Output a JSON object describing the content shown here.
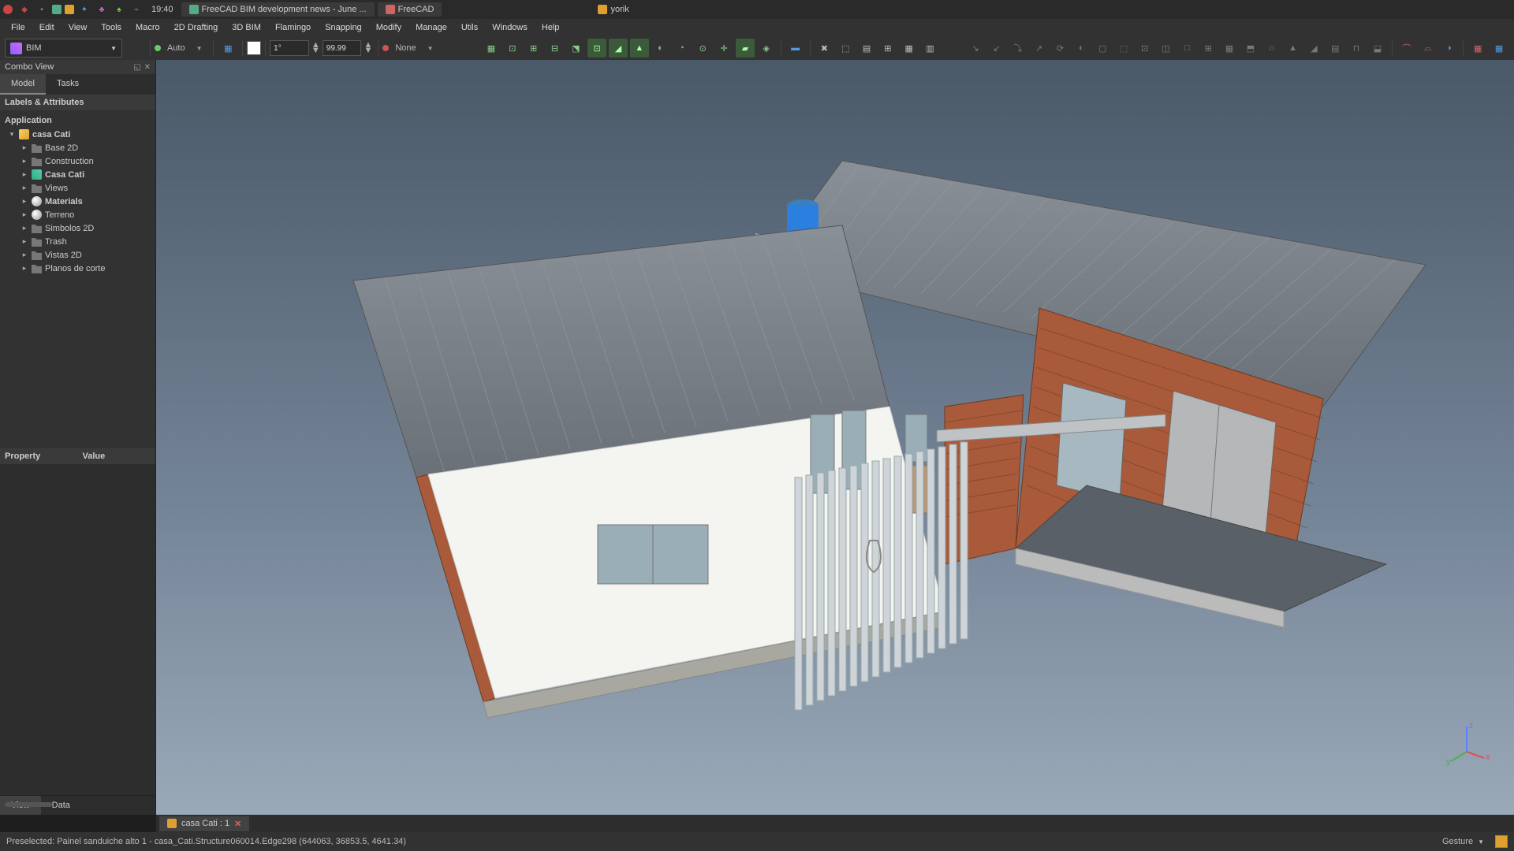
{
  "titlebar": {
    "time": "19:40",
    "wtabs": [
      {
        "label": "FreeCAD BIM development news - June ...",
        "icon": "#5a8"
      },
      {
        "label": "FreeCAD",
        "icon": "#c66"
      },
      {
        "label": "yorik",
        "icon": "#e0a030"
      }
    ]
  },
  "menu": [
    "File",
    "Edit",
    "View",
    "Tools",
    "Macro",
    "2D Drafting",
    "3D BIM",
    "Flamingo",
    "Snapping",
    "Modify",
    "Manage",
    "Utils",
    "Windows",
    "Help"
  ],
  "workbench": "BIM",
  "toolbar1": {
    "auto_label": "Auto",
    "size_unit": "1°",
    "size_val": "99.99",
    "none_label": "None"
  },
  "combo": {
    "title": "Combo View",
    "tabs": [
      "Model",
      "Tasks"
    ],
    "tree_header": "Labels & Attributes",
    "root": "Application",
    "project": "casa Cati",
    "items": [
      {
        "label": "Base 2D",
        "type": "folder"
      },
      {
        "label": "Construction",
        "type": "folder"
      },
      {
        "label": "Casa Cati",
        "type": "project",
        "bold": true
      },
      {
        "label": "Views",
        "type": "folder"
      },
      {
        "label": "Materials",
        "type": "material",
        "bold": true
      },
      {
        "label": "Terreno",
        "type": "material"
      },
      {
        "label": "Simbolos 2D",
        "type": "folder"
      },
      {
        "label": "Trash",
        "type": "folder"
      },
      {
        "label": "Vistas 2D",
        "type": "folder"
      },
      {
        "label": "Planos de corte",
        "type": "folder"
      }
    ],
    "prop_headers": [
      "Property",
      "Value"
    ],
    "bottom_tabs": [
      "View",
      "Data"
    ]
  },
  "doctab": {
    "label": "casa Cati : 1"
  },
  "status": {
    "text": "Preselected: Painel sanduiche alto 1 - casa_Cati.Structure060014.Edge298 (644063, 36853.5, 4641.34)",
    "nav_mode": "Gesture"
  }
}
